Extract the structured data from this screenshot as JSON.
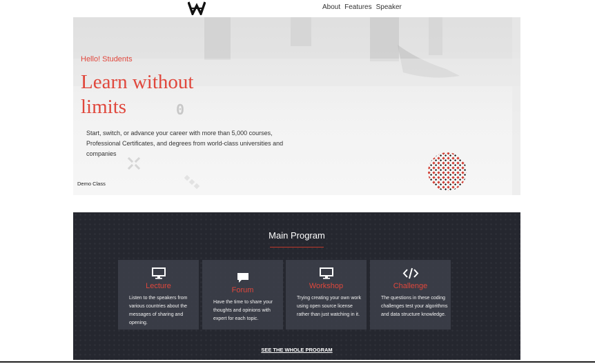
{
  "nav": {
    "logo_icon": "w-logo-icon",
    "links": [
      "About",
      "Features",
      "Speaker"
    ]
  },
  "hero": {
    "eyebrow": "Hello! Students",
    "title_line1": "Learn without",
    "title_line2": "limits",
    "description": "Start, switch, or advance your career with more than 5,000 courses, Professional Certificates, and degrees from world-class universities and companies",
    "demo_label": "Demo Class",
    "deco_zero": "0",
    "accent_color": "#e0473c"
  },
  "program": {
    "title": "Main Program",
    "cards": [
      {
        "icon": "monitor-icon",
        "title": "Lecture",
        "text": "Listen to the speakers from various countries about the messages of sharing and opening."
      },
      {
        "icon": "chat-bubble-icon",
        "title": "Forum",
        "text": "Have the time to share your thoughts and opinions with expert for each topic."
      },
      {
        "icon": "monitor-icon",
        "title": "Workshop",
        "text": "Trying creating your own work using open source license rather than just watching in it."
      },
      {
        "icon": "code-icon",
        "title": "Challenge",
        "text": "The questions in these coding challenges test your algorithms and data structure knowledge."
      }
    ],
    "cta": "SEE THE WHOLE PROGRAM",
    "background_color": "#25272f"
  }
}
